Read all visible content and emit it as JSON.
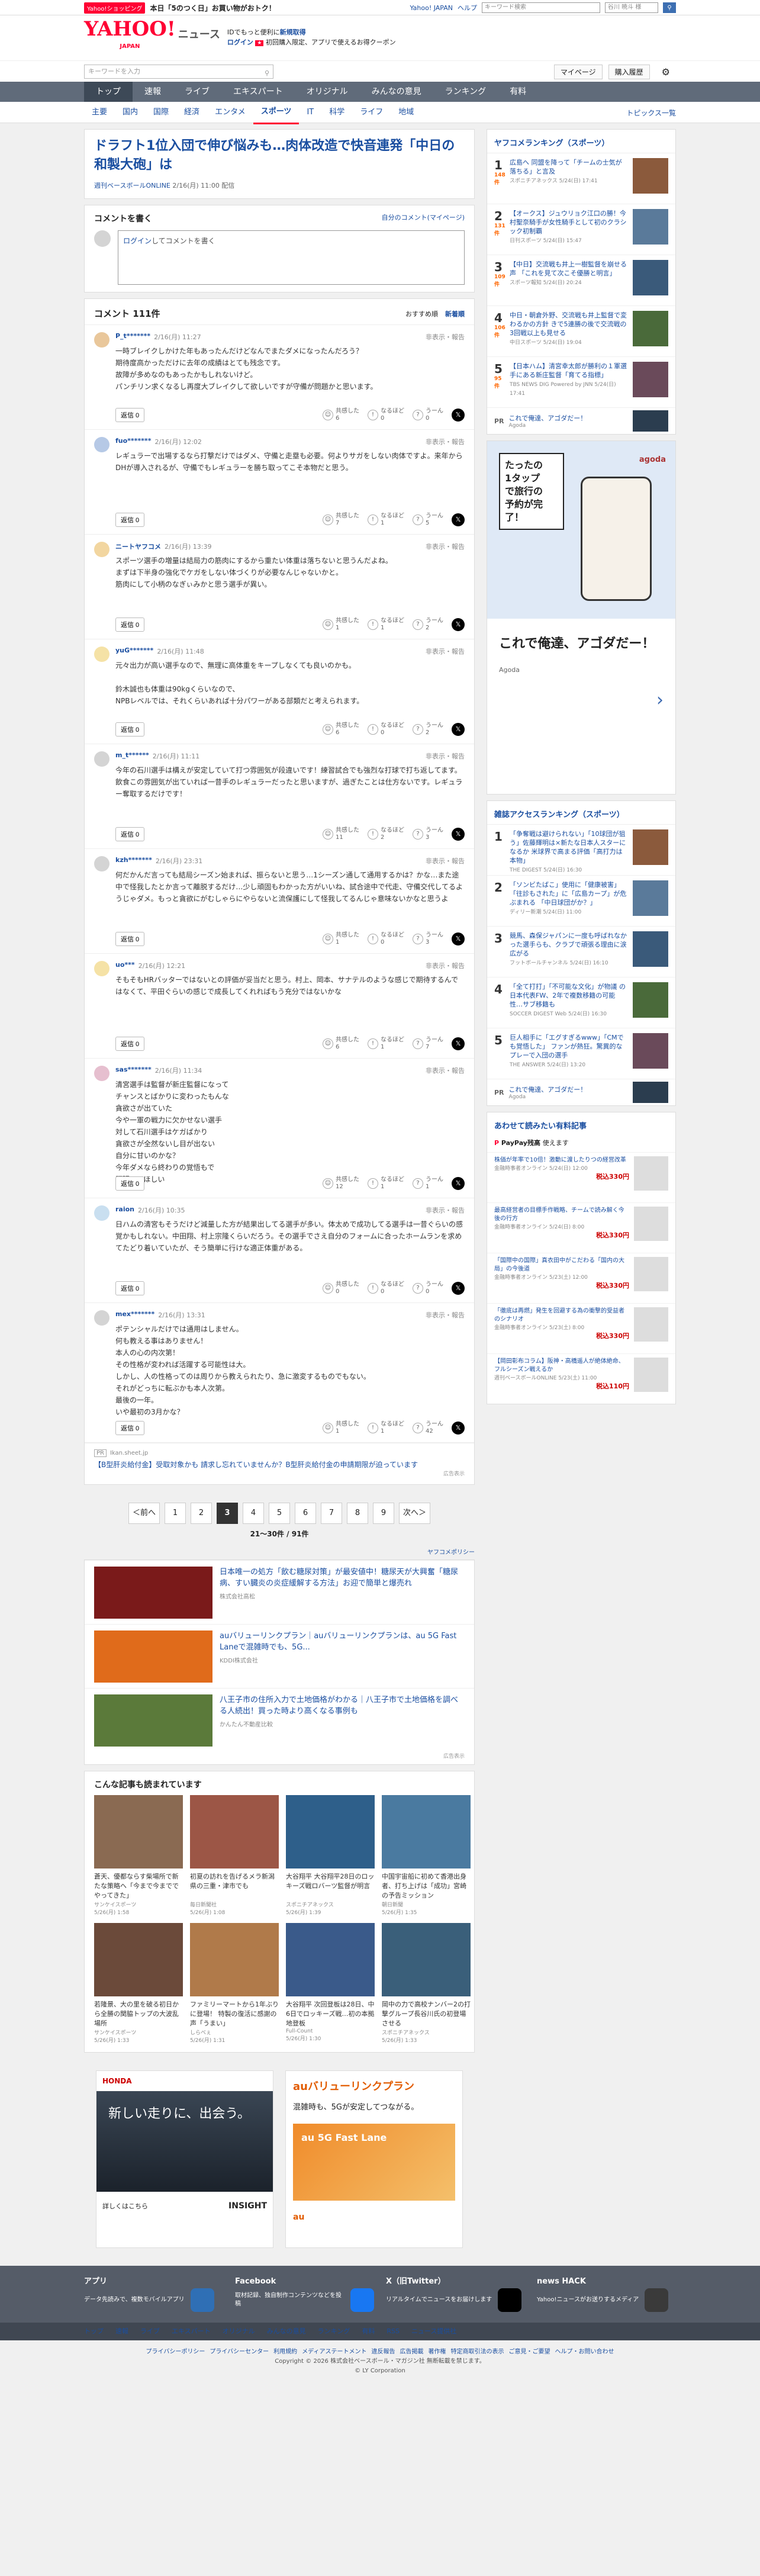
{
  "promo": {
    "badge": "Yahoo!ショッピング",
    "text": "本日「5のつく日」お買い物がおトク！",
    "links": [
      "Yahoo! JAPAN",
      "ヘルプ"
    ],
    "search_placeholder": "キーワード検索",
    "user": "谷川 暁斗 様"
  },
  "header": {
    "logo": "YAHOO!",
    "logo_sub": "JAPAN",
    "service": "ニュース",
    "info1": "IDでもっと便利に",
    "info1_link": "新規取得",
    "login": "ログイン",
    "info2": "初回購入限定、アプリで使えるお得クーポン"
  },
  "srow": {
    "placeholder": "キーワードを入力",
    "mypage": "マイページ",
    "subscribe": "購入履歴",
    "gear": "⚙"
  },
  "nav": {
    "items": [
      "トップ",
      "速報",
      "ライブ",
      "エキスパート",
      "オリジナル",
      "みんなの意見",
      "ランキング",
      "有料"
    ]
  },
  "subnav": {
    "items": [
      "主要",
      "国内",
      "国際",
      "経済",
      "エンタメ",
      "スポーツ",
      "IT",
      "科学",
      "ライフ",
      "地域"
    ],
    "right": "トピックス一覧"
  },
  "article": {
    "title": "ドラフト1位入団で伸び悩みも…肉体改造で快音連発「中日の和製大砲」は",
    "source": "週刊ベースボールONLINE",
    "time": "2/16(月) 11:00 配信"
  },
  "comment_write": {
    "title": "コメントを書く",
    "my_comments": "自分のコメント(マイページ)",
    "login": "ログイン",
    "prompt": "してコメントを書く"
  },
  "comments_header": {
    "title": "コメント 111件",
    "sort1": "おすすめ順",
    "sort2": "新着順"
  },
  "comments": [
    {
      "user": "P_t*******",
      "time": "2/16(月) 11:27",
      "text": "一時ブレイクしかけた年もあったんだけどなんでまたダメになったんだろう？\n期待度高かっただけに去年の成績はとても残念です。\n故障が多めなのもあったかもしれないけど。\nパンチリン求くなるし再度大ブレイクして欲しいですが守備が問題かと思います。",
      "reply": "返信 0",
      "kyokan": "6",
      "naruhodo": "0",
      "unun": "0",
      "bg": "#e9c79b"
    },
    {
      "user": "fuo*******",
      "time": "2/16(月) 12:02",
      "text": "レギュラーで出場するなら打撃だけではダメ、守備と走塁も必要。何よりサガをしない肉体ですよ。来年からDHが導入されるが、守備でもレギュラーを勝ち取ってこそ本物だと思う。",
      "reply": "返信 0",
      "kyokan": "7",
      "naruhodo": "1",
      "unun": "5",
      "bg": "#b6c9e6"
    },
    {
      "user": "ニートヤフコメ",
      "time": "2/16(月) 13:39",
      "text": "スポーツ選手の増量は結局力の筋肉にするから重たい体重は落ちないと思うんだよね。\nまずは下半身の強化でケガをしない体づくりが必要なんじゃないかと。\n筋肉にして小柄のなぎぃみかと思う選手が異い。",
      "reply": "返信 0",
      "kyokan": "1",
      "naruhodo": "1",
      "unun": "2",
      "bg": "#f2d6a0"
    },
    {
      "user": "yuG*******",
      "time": "2/16(月) 11:48",
      "text": "元々出力が高い選手なので、無理に高体重をキープしなくても良いのかも。\n\n鈴木誠也も体重は90kgくらいなので、\nNPBレベルでは、それくらいあれば十分パワーがある部類だと考えられます。",
      "reply": "返信 0",
      "kyokan": "6",
      "naruhodo": "0",
      "unun": "2",
      "bg": "#f5e2a6"
    },
    {
      "user": "m_t******",
      "time": "2/16(月) 11:11",
      "text": "今年の石川選手は構えが安定していて打つ雰囲気が段違いです！練習試合でも強烈な打球で打ち返してます。\n飲食この雰囲気が出ていれば一昔手のレギュラーだったと思いますが、過ぎたことは仕方ないです。レギュラー奪取するだけです！",
      "reply": "返信 0",
      "kyokan": "11",
      "naruhodo": "2",
      "unun": "3",
      "bg": "#d4d4d4"
    },
    {
      "user": "kzh*******",
      "time": "2/16(月) 23:31",
      "text": "何だかんだ言っても結局シーズン始まれば、振らないと思う…1シーズン通して通用するかは？かな…また途中で怪我したとか言って離脱するだけ…少し頑固もわかった方がいいね、試合途中で代走、守備交代してるようじゃダメ。もっと貪欲にがむしゃらにやらないと流保護にして怪我してるんじゃ意味ないかなと思うよ",
      "reply": "返信 0",
      "kyokan": "1",
      "naruhodo": "0",
      "unun": "3",
      "bg": "#d4d4d4"
    },
    {
      "user": "uo***",
      "time": "2/16(月) 12:21",
      "text": "そもそもHRバッターではないとの評価が妥当だと思う。村上、岡本、サナテルのような感じで期待するんではなくて、平田ぐらいの感じで成長してくれればもう充分ではないかな",
      "reply": "返信 0",
      "kyokan": "6",
      "naruhodo": "1",
      "unun": "7",
      "bg": "#f5e2a6"
    },
    {
      "user": "sas*******",
      "time": "2/16(月) 11:34",
      "text": "清宮選手は監督が新庄監督になって\nチャンスとばかりに変わったもんな\n貪欲さが出ていた\n今や一軍の戦力に欠かせない選手\n対して石川選手はケガばかり\n貪欲さが全然ないし目が出ない\n自分に甘いのかな？\n今年ダメなら終わりの覚悟もで\n頑張ってほしい",
      "reply": "返信 0",
      "kyokan": "12",
      "naruhodo": "1",
      "unun": "1",
      "bg": "#e6bfcf",
      "tall": true
    },
    {
      "user": "raion",
      "time": "2/16(月) 10:35",
      "text": "日ハムの清宮もそうだけど減量した方が結果出してる選手が多い。体太めで成功してる選手は一昔ぐらいの感覚かもしれない。中田翔、村上宗隆くらいだろう。その選手でさえ自分のフォームに合ったホームランを求めてたどり着いていたが、そう簡単に行けな適正体重がある。",
      "reply": "返信 0",
      "kyokan": "0",
      "naruhodo": "0",
      "unun": "0",
      "bg": "#c9dff0"
    },
    {
      "user": "mex*******",
      "time": "2/16(月) 13:31",
      "text": "ポテンシャルだけでは通用はしません。\n何も教える事はありません！\n本人の心の内次第！\nその性格が変われば活躍する可能性は大。\nしかし、人の性格ってのは周りから教えられたり、急に激変するものでもない。\nそれがどっちに転ぶかも本人次第。\n最後の一年。\nいや最初の3月かな？",
      "reply": "返信 0",
      "kyokan": "1",
      "naruhodo": "1",
      "unun": "42",
      "bg": "#d4d4d4",
      "tall": true
    }
  ],
  "vote_labels": {
    "kyokan": "共感した",
    "naruhodo": "なるほど",
    "unun": "うーん"
  },
  "report_label": "非表示・報告",
  "pr_ad": {
    "label": "PR",
    "sponsor": "Ikan.sheet.jp",
    "text": "【B型肝炎給付金】受取対象かも 請求し忘れていませんか？B型肝炎給付金の申請期限が迫っています",
    "info": "広告表示"
  },
  "pagination": {
    "prev": "＜前へ",
    "pages": [
      "1",
      "2",
      "3",
      "4",
      "5",
      "6",
      "7",
      "8",
      "9"
    ],
    "current": "3",
    "next": "次へ＞",
    "info": "21〜30件 / 91件"
  },
  "yahoo_ads_label": "ヤフコメポリシー",
  "ad_rows": [
    {
      "text": "日本唯一の処方「飲む糖尿対策」が最安値中！糖尿天が大興奮「糖尿病、すい臓炎の炎症緩解する方法」お迎で簡単と爆売れ",
      "sub": "株式会社高松",
      "color": "#7a1a1a"
    },
    {
      "text": "auバリューリンクプラン｜auバリューリンクプランは、au 5G Fast Laneで混雑時でも、5G...",
      "sub": "KDDI株式会社",
      "color": "#e06b1b"
    },
    {
      "text": "八王子市の住所入力で土地価格がわかる｜八王子市で土地価格を調べる人続出！買った時より高くなる事例も",
      "sub": "かんたん不動産比較",
      "color": "#5b7a3a"
    }
  ],
  "ad_info": "広告表示",
  "read_also": {
    "title": "こんな記事も読まれています",
    "items": [
      {
        "t": "蒼天、優都ならす柴場所で新たな策略へ「今まで今まででやってきた」",
        "s": "サンケイスポーツ",
        "d": "5/26(月) 1:58",
        "c": "#8a6a52"
      },
      {
        "t": "初夏の訪れを告げるメラ新潟県の三重・津市でも",
        "s": "毎日新聞社",
        "d": "5/26(月) 1:08",
        "c": "#9c5646"
      },
      {
        "t": "大谷翔平 大谷翔平28日のロッキーズ戦ロバーツ監督が明言",
        "s": "スポニチアネックス",
        "d": "5/26(月) 1:39",
        "c": "#2e5f8a"
      },
      {
        "t": "中国宇宙船に初めて香港出身者、打ち上げは「成功」宮崎の予告ミッション",
        "s": "朝日新聞",
        "d": "5/26(月) 1:35",
        "c": "#4a7aa0"
      },
      {
        "t": "若隆景、大の里を破る初日から全勝の関脇トップの大波乱場所",
        "s": "サンケイスポーツ",
        "d": "5/26(月) 1:33",
        "c": "#6b4a3a"
      },
      {
        "t": "ファミリーマートから1年ぶりに登場！ 特製の復活に感謝の声「うまい」",
        "s": "しらべぇ",
        "d": "5/26(月) 1:31",
        "c": "#b07a4a"
      },
      {
        "t": "大谷翔平 次回登板は28日、中6日でロッキーズ戦…初の本拠地登板",
        "s": "Full-Count",
        "d": "5/26(月) 1:30",
        "c": "#3a5a8a"
      },
      {
        "t": "岡中の力で高校ナンバー2の打撃グループ長谷川氏の初登場させる",
        "s": "スポニチアネックス",
        "d": "5/26(月) 1:33",
        "c": "#3a5f7a"
      }
    ]
  },
  "bottom_ads": [
    {
      "brand": "HONDA",
      "text": "新しい走りに、出会う。",
      "sub": "詳しくはこちら",
      "tag": "INSIGHT"
    },
    {
      "brand": "au",
      "text": "auバリューリンクプラン",
      "sub": "混雑時も、5Gが安定してつながる。",
      "tag": "au 5G Fast Lane"
    }
  ],
  "ranking1": {
    "title": "ヤフコメランキング（スポーツ）",
    "items": [
      {
        "n": "1",
        "c": "148件",
        "t": "広島へ 同盟を降って「チームの士気が落ちる」と言及",
        "s": "スポニチアネックス 5/24(日) 17:41"
      },
      {
        "n": "2",
        "c": "131件",
        "t": "【オークス】ジュウリョク江口の勝！今村聖奈騎手が女性騎手として初のクラシック初制覇",
        "s": "日刊スポーツ 5/24(日) 15:47"
      },
      {
        "n": "3",
        "c": "109件",
        "t": "【中日】交流戦も井上一樹監督を崩せる声 「これを見て次こそ優勝と明言」",
        "s": "スポーツ報知 5/24(日) 20:24"
      },
      {
        "n": "4",
        "c": "106件",
        "t": "中日・朝倉外野、交流戦も井上監督で変わるかの方針 きで5連勝の後で交流戦の3回戦以上も見せる",
        "s": "中日スポーツ 5/24(日) 19:04"
      },
      {
        "n": "5",
        "c": "95件",
        "t": "【日本ハム】清宮幸太郎が勝利の１軍選手にある新庄監督「育てる指標」",
        "s": "TBS NEWS DIG Powered by JNN 5/24(日) 17:41"
      }
    ]
  },
  "pr1": {
    "label": "PR",
    "text": "これで俺達、アゴダだー！",
    "sub": "Agoda"
  },
  "ad_big": {
    "brand": "agoda",
    "headline": "たったの\n1タップ\nで旅行の\n予約が完了！",
    "tag": "これで俺達、アゴダだー！",
    "sponsor": "Agoda"
  },
  "ranking2": {
    "title": "雑誌アクセスランキング（スポーツ）",
    "items": [
      {
        "n": "1",
        "t": "「争奪戦は避けられない」「10球団が狙う」佐藤輝明は×新たな日本人スターになるか 米球界で高まる評価「高打力は本物」",
        "s": "THE DIGEST 5/24(日) 16:30"
      },
      {
        "n": "2",
        "t": "「ソンビたばこ」使用に「健康被害」「往診もされた」に「広島カープ」が危ぶまれる 「中日球団がか？」",
        "s": "ディリー新潮 5/24(日) 11:00"
      },
      {
        "n": "3",
        "t": "競馬、森保ジャパンに一度も呼ばれなかった選手らも、クラブで頑張る理由に涙広がる",
        "s": "フットボールチャンネル 5/24(日) 16:10"
      },
      {
        "n": "4",
        "t": "「全て打打」「不可能な文化」が物議 の日本代表FW、2年で複数移籍の可能性…サブ移籍も",
        "s": "SOCCER DIGEST Web 5/24(日) 16:30"
      },
      {
        "n": "5",
        "t": "巨人相手に「エグすぎるwww」「CMでも覚悟した」 ファンが熱狂。驚異的なプレーで入団の選手",
        "s": "THE ANSWER 5/24(日) 13:20"
      }
    ]
  },
  "pr2": {
    "label": "PR",
    "text": "これで俺達、アゴダだー！",
    "sub": "Agoda"
  },
  "shop": {
    "title": "あわせて読みたい有料記事",
    "brand": "PayPay残高",
    "brand_sub": "使えます",
    "items": [
      {
        "t": "株価が年率で10倍！激動に渡したりつの経営改革",
        "s": "金融時事者オンライン 5/24(日) 12:00",
        "p": "税込330円"
      },
      {
        "t": "最高経営者の目標手作戦略、チームで読み解く今後の行方",
        "s": "金融時事者オンライン 5/24(日) 8:00",
        "p": "税込330円"
      },
      {
        "t": "「国際中の国際」真衣田中がこだわる「国内の大局」の今後道",
        "s": "金融時事者オンライン 5/23(土) 12:00",
        "p": "税込330円"
      },
      {
        "t": "「徹底は再燃」発生を回避する為の衝撃的受益者のシナリオ",
        "s": "金融時事者オンライン 5/23(土) 8:00",
        "p": "税込330円"
      },
      {
        "t": "【岡田彰布コラム】阪神・高橋遥人が絶体絶命、フルシーズン戦えるか",
        "s": "週刊ベースボールONLINE 5/23(土) 11:00",
        "p": "税込110円"
      }
    ]
  },
  "footer": {
    "apps": [
      {
        "title": "アプリ",
        "text": "データ先読みで、複数モバイルアプリ",
        "color": "#2f6fb5"
      },
      {
        "title": "Facebook",
        "text": "取材記録、独自制作コンテンツなどを投稿",
        "color": "#1877f2"
      },
      {
        "title": "X（旧Twitter）",
        "text": "リアルタイムでニュースをお届けします",
        "color": "#000"
      },
      {
        "title": "news HACK",
        "text": "Yahoo!ニュースがお送りするメディア",
        "color": "#3a3a3a"
      }
    ],
    "nav": [
      "トップ",
      "速報",
      "ライブ",
      "エキスパート",
      "オリジナル",
      "みんなの意見",
      "ランキング",
      "有料",
      "RSS",
      "ニュース提供社"
    ],
    "links": [
      "プライバシーポリシー",
      "プライバシーセンター",
      "利用規約",
      "メディアステートメント",
      "違反報告",
      "広告掲載",
      "著作権",
      "特定商取引法の表示",
      "ご意見・ご要望",
      "ヘルプ・お問い合わせ"
    ],
    "copyright1": "Copyright © 2026 株式会社ベースボール・マガジン社 無断転載を禁じます。",
    "copyright2": "© LY Corporation"
  }
}
